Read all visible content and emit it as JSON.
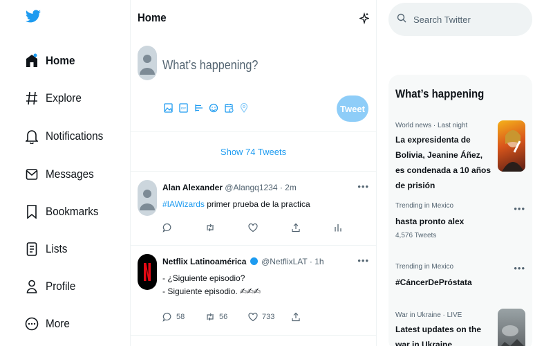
{
  "nav": {
    "items": [
      {
        "label": "Home",
        "icon": "home-icon"
      },
      {
        "label": "Explore",
        "icon": "hashtag-icon"
      },
      {
        "label": "Notifications",
        "icon": "bell-icon"
      },
      {
        "label": "Messages",
        "icon": "envelope-icon"
      },
      {
        "label": "Bookmarks",
        "icon": "bookmark-icon"
      },
      {
        "label": "Lists",
        "icon": "list-icon"
      },
      {
        "label": "Profile",
        "icon": "person-icon"
      },
      {
        "label": "More",
        "icon": "more-circle-icon"
      }
    ]
  },
  "timeline": {
    "title": "Home",
    "compose": {
      "placeholder": "What’s happening?",
      "tweet_label": "Tweet"
    },
    "show_tweets": "Show 74 Tweets",
    "tweets": [
      {
        "name": "Alan Alexander",
        "handle": "@Alangq1234 · 2m",
        "hashtag": "#IAWizards",
        "text": " primer prueba de la practica",
        "replies": "",
        "retweets": "",
        "likes": ""
      },
      {
        "name": "Netflix Latinoamérica",
        "handle": "@NetflixLAT · 1h",
        "line1": "- ¿Siguiente episodio?",
        "line2": "- Siguiente episodio. ✍✍✍",
        "replies": "58",
        "retweets": "56",
        "likes": "733"
      }
    ]
  },
  "sidebar": {
    "search_placeholder": "Search Twitter",
    "trends_title": "What’s happening",
    "trends": [
      {
        "meta": "World news · Last night",
        "title": "La expresidenta de Bolivia, Jeanine Áñez, es condenada a 10 años de prisión",
        "count": ""
      },
      {
        "meta": "Trending in Mexico",
        "title": "hasta pronto alex",
        "count": "4,576 Tweets"
      },
      {
        "meta": "Trending in Mexico",
        "title": "#CáncerDePróstata",
        "count": ""
      },
      {
        "meta": "War in Ukraine · LIVE",
        "title": "Latest updates on the war in Ukraine",
        "count": ""
      }
    ]
  },
  "colors": {
    "accent": "#1d9bf0",
    "tweet_button": "#8ecdf8"
  }
}
